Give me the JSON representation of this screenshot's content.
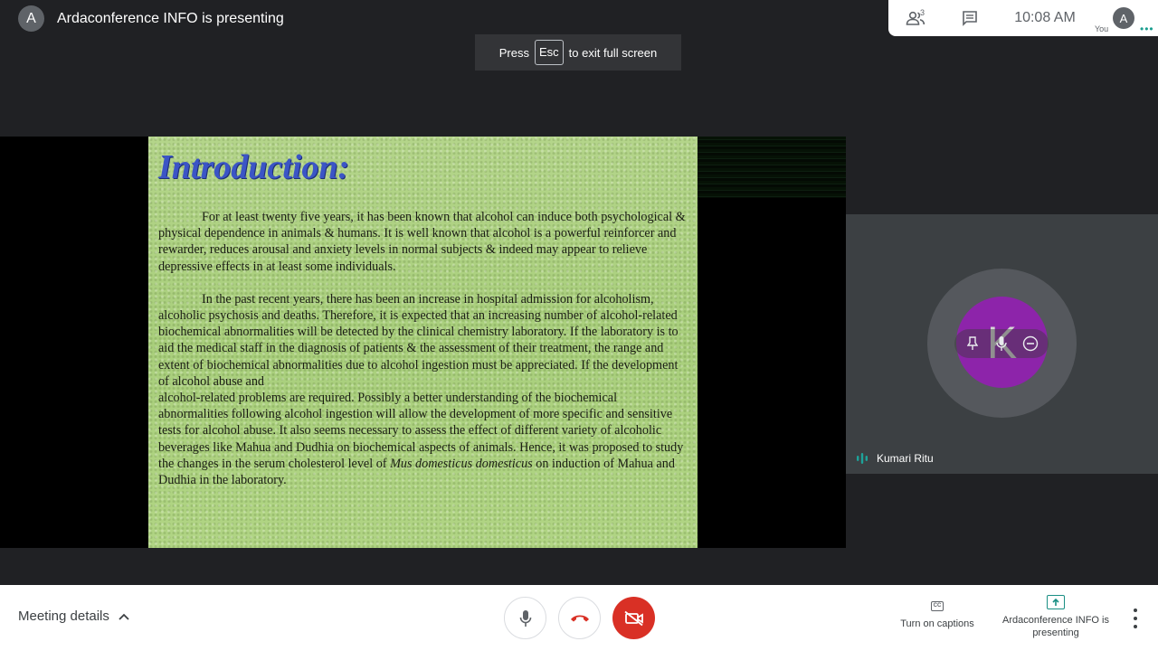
{
  "presenter": {
    "avatar_letter": "A",
    "title": "Ardaconference INFO is presenting"
  },
  "toast": {
    "press": "Press",
    "key": "Esc",
    "suffix": "to exit full screen"
  },
  "top_right": {
    "people_icon": "people-icon",
    "people_count": "3",
    "chat_icon": "chat-icon",
    "time": "10:08 AM",
    "you_avatar_letter": "A",
    "you_label": "You"
  },
  "slide": {
    "title": "Introduction:",
    "paragraph1": "For at least twenty five years, it has been known that alcohol can induce both psychological & physical dependence in animals & humans. It is well known that alcohol is a powerful reinforcer and rewarder, reduces arousal and anxiety levels in normal subjects & indeed may appear to relieve depressive effects in at least some individuals.",
    "paragraph2_a": "In the past recent years, there has been an increase in hospital admission for alcoholism, alcoholic psychosis and deaths. Therefore, it is expected that an increasing number of alcohol-related biochemical abnormalities will be detected by the clinical chemistry laboratory. If the laboratory is to aid the medical staff in the diagnosis of patients & the assessment of their treatment, the range and extent of biochemical abnormalities due to alcohol ingestion must be appreciated. If the development of alcohol abuse and",
    "paragraph2_b": "alcohol-related problems are required. Possibly a better understanding of the biochemical abnormalities following alcohol ingestion will allow the development of more specific and sensitive tests for alcohol abuse. It also seems necessary to assess the effect of different variety of alcoholic beverages like Mahua and Dudhia on biochemical aspects of animals. Hence, it was proposed to study the changes in the serum cholesterol level of",
    "species": "Mus domesticus domesticus",
    "paragraph2_c": "on induction of Mahua and Dudhia in the laboratory."
  },
  "participant": {
    "avatar_letter": "K",
    "name": "Kumari Ritu",
    "avatar_color": "#8d24aa"
  },
  "bottom": {
    "meeting_details": "Meeting details",
    "captions_label": "Turn on captions",
    "captions_icon_text": "CC",
    "presenting_label": "Ardaconference INFO is presenting",
    "hangup_color": "#d93025",
    "camera_off_color": "#d93025"
  }
}
